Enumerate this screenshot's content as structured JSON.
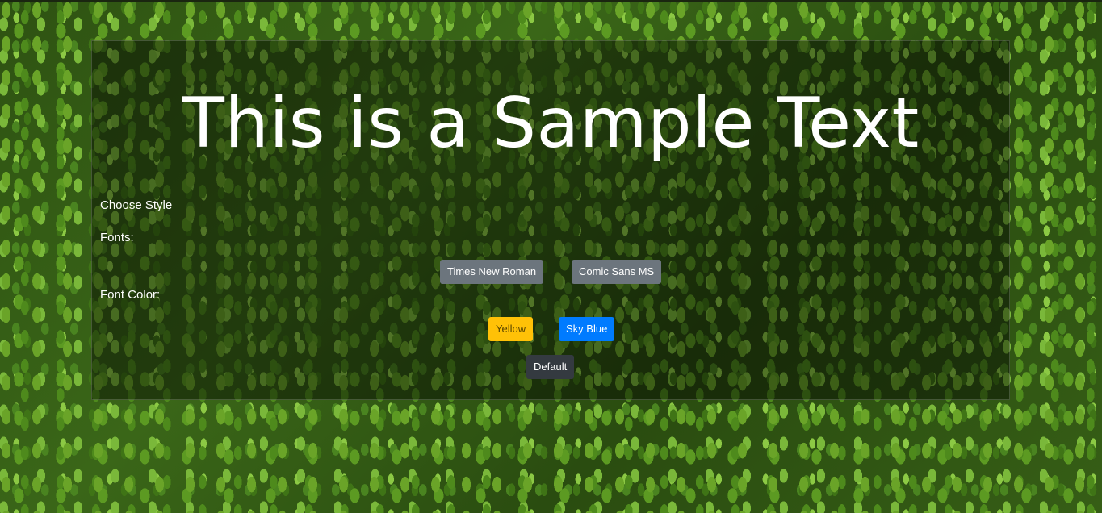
{
  "sample": {
    "text": "This is a Sample Text"
  },
  "controls": {
    "choose_style_label": "Choose Style",
    "fonts_label": "Fonts:",
    "font_color_label": "Font Color:"
  },
  "font_buttons": {
    "times_new_roman": "Times New Roman",
    "comic_sans": "Comic Sans MS"
  },
  "color_buttons": {
    "yellow": "Yellow",
    "sky_blue": "Sky Blue",
    "default": "Default"
  },
  "colors": {
    "secondary": "#6c757d",
    "yellow": "#ffc107",
    "blue": "#007bff",
    "dark": "#343a40",
    "text": "#ffffff"
  }
}
